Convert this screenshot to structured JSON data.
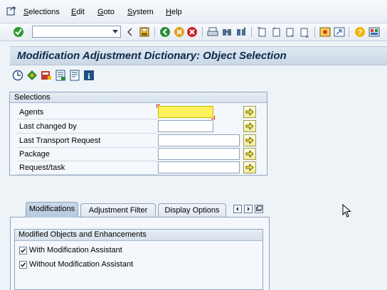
{
  "menubar": {
    "items": [
      "Selections",
      "Edit",
      "Goto",
      "System",
      "Help"
    ]
  },
  "toolbar": {
    "command_field_value": "",
    "icons": [
      "enter-icon",
      "back-icon",
      "save-icon",
      "back-icon",
      "exit-icon",
      "cancel-icon",
      "print-icon",
      "find-icon",
      "find-next-icon",
      "first-page-icon",
      "previous-page-icon",
      "next-page-icon",
      "last-page-icon",
      "create-session-icon",
      "shortcut-icon",
      "help-icon",
      "customize-layout-icon"
    ]
  },
  "page": {
    "title": "Modification Adjustment Dictionary: Object Selection"
  },
  "app_toolbar": {
    "icons": [
      "execute-icon",
      "variants-icon",
      "save-variant-icon",
      "get-variant-icon",
      "documentation-icon",
      "info-icon"
    ]
  },
  "selections": {
    "header": "Selections",
    "rows": [
      {
        "label": "Agents",
        "value": ""
      },
      {
        "label": "Last changed by",
        "value": ""
      },
      {
        "label": "Last Transport Request",
        "value": ""
      },
      {
        "label": "Package",
        "value": ""
      },
      {
        "label": "Request/task",
        "value": ""
      }
    ]
  },
  "tabs": [
    {
      "label": "Modifications",
      "active": true
    },
    {
      "label": "Adjustment Filter",
      "active": false
    },
    {
      "label": "Display Options",
      "active": false
    }
  ],
  "modified_objects": {
    "header": "Modified Objects and Enhancements",
    "options": [
      {
        "label": "With Modification Assistant",
        "checked": true
      },
      {
        "label": "Without Modification Assistant",
        "checked": true
      }
    ]
  }
}
